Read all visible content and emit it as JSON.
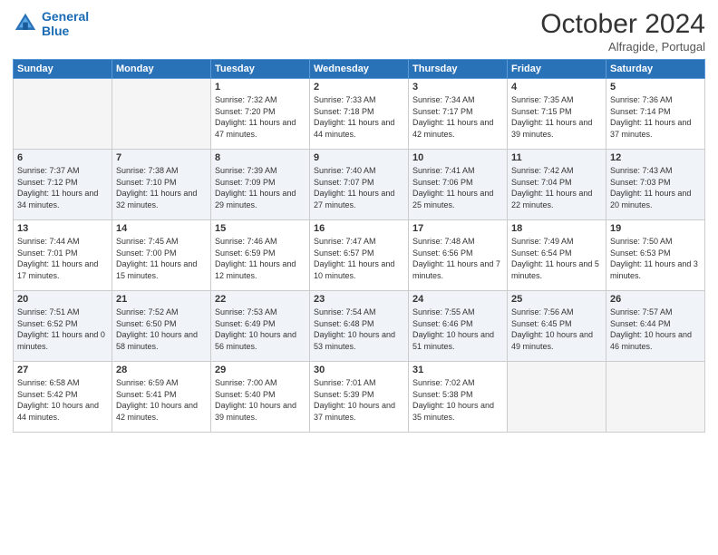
{
  "header": {
    "logo_line1": "General",
    "logo_line2": "Blue",
    "month_title": "October 2024",
    "location": "Alfragide, Portugal"
  },
  "days_of_week": [
    "Sunday",
    "Monday",
    "Tuesday",
    "Wednesday",
    "Thursday",
    "Friday",
    "Saturday"
  ],
  "weeks": [
    [
      {
        "day": "",
        "sunrise": "",
        "sunset": "",
        "daylight": "",
        "empty": true
      },
      {
        "day": "",
        "sunrise": "",
        "sunset": "",
        "daylight": "",
        "empty": true
      },
      {
        "day": "1",
        "sunrise": "Sunrise: 7:32 AM",
        "sunset": "Sunset: 7:20 PM",
        "daylight": "Daylight: 11 hours and 47 minutes.",
        "empty": false
      },
      {
        "day": "2",
        "sunrise": "Sunrise: 7:33 AM",
        "sunset": "Sunset: 7:18 PM",
        "daylight": "Daylight: 11 hours and 44 minutes.",
        "empty": false
      },
      {
        "day": "3",
        "sunrise": "Sunrise: 7:34 AM",
        "sunset": "Sunset: 7:17 PM",
        "daylight": "Daylight: 11 hours and 42 minutes.",
        "empty": false
      },
      {
        "day": "4",
        "sunrise": "Sunrise: 7:35 AM",
        "sunset": "Sunset: 7:15 PM",
        "daylight": "Daylight: 11 hours and 39 minutes.",
        "empty": false
      },
      {
        "day": "5",
        "sunrise": "Sunrise: 7:36 AM",
        "sunset": "Sunset: 7:14 PM",
        "daylight": "Daylight: 11 hours and 37 minutes.",
        "empty": false
      }
    ],
    [
      {
        "day": "6",
        "sunrise": "Sunrise: 7:37 AM",
        "sunset": "Sunset: 7:12 PM",
        "daylight": "Daylight: 11 hours and 34 minutes.",
        "empty": false
      },
      {
        "day": "7",
        "sunrise": "Sunrise: 7:38 AM",
        "sunset": "Sunset: 7:10 PM",
        "daylight": "Daylight: 11 hours and 32 minutes.",
        "empty": false
      },
      {
        "day": "8",
        "sunrise": "Sunrise: 7:39 AM",
        "sunset": "Sunset: 7:09 PM",
        "daylight": "Daylight: 11 hours and 29 minutes.",
        "empty": false
      },
      {
        "day": "9",
        "sunrise": "Sunrise: 7:40 AM",
        "sunset": "Sunset: 7:07 PM",
        "daylight": "Daylight: 11 hours and 27 minutes.",
        "empty": false
      },
      {
        "day": "10",
        "sunrise": "Sunrise: 7:41 AM",
        "sunset": "Sunset: 7:06 PM",
        "daylight": "Daylight: 11 hours and 25 minutes.",
        "empty": false
      },
      {
        "day": "11",
        "sunrise": "Sunrise: 7:42 AM",
        "sunset": "Sunset: 7:04 PM",
        "daylight": "Daylight: 11 hours and 22 minutes.",
        "empty": false
      },
      {
        "day": "12",
        "sunrise": "Sunrise: 7:43 AM",
        "sunset": "Sunset: 7:03 PM",
        "daylight": "Daylight: 11 hours and 20 minutes.",
        "empty": false
      }
    ],
    [
      {
        "day": "13",
        "sunrise": "Sunrise: 7:44 AM",
        "sunset": "Sunset: 7:01 PM",
        "daylight": "Daylight: 11 hours and 17 minutes.",
        "empty": false
      },
      {
        "day": "14",
        "sunrise": "Sunrise: 7:45 AM",
        "sunset": "Sunset: 7:00 PM",
        "daylight": "Daylight: 11 hours and 15 minutes.",
        "empty": false
      },
      {
        "day": "15",
        "sunrise": "Sunrise: 7:46 AM",
        "sunset": "Sunset: 6:59 PM",
        "daylight": "Daylight: 11 hours and 12 minutes.",
        "empty": false
      },
      {
        "day": "16",
        "sunrise": "Sunrise: 7:47 AM",
        "sunset": "Sunset: 6:57 PM",
        "daylight": "Daylight: 11 hours and 10 minutes.",
        "empty": false
      },
      {
        "day": "17",
        "sunrise": "Sunrise: 7:48 AM",
        "sunset": "Sunset: 6:56 PM",
        "daylight": "Daylight: 11 hours and 7 minutes.",
        "empty": false
      },
      {
        "day": "18",
        "sunrise": "Sunrise: 7:49 AM",
        "sunset": "Sunset: 6:54 PM",
        "daylight": "Daylight: 11 hours and 5 minutes.",
        "empty": false
      },
      {
        "day": "19",
        "sunrise": "Sunrise: 7:50 AM",
        "sunset": "Sunset: 6:53 PM",
        "daylight": "Daylight: 11 hours and 3 minutes.",
        "empty": false
      }
    ],
    [
      {
        "day": "20",
        "sunrise": "Sunrise: 7:51 AM",
        "sunset": "Sunset: 6:52 PM",
        "daylight": "Daylight: 11 hours and 0 minutes.",
        "empty": false
      },
      {
        "day": "21",
        "sunrise": "Sunrise: 7:52 AM",
        "sunset": "Sunset: 6:50 PM",
        "daylight": "Daylight: 10 hours and 58 minutes.",
        "empty": false
      },
      {
        "day": "22",
        "sunrise": "Sunrise: 7:53 AM",
        "sunset": "Sunset: 6:49 PM",
        "daylight": "Daylight: 10 hours and 56 minutes.",
        "empty": false
      },
      {
        "day": "23",
        "sunrise": "Sunrise: 7:54 AM",
        "sunset": "Sunset: 6:48 PM",
        "daylight": "Daylight: 10 hours and 53 minutes.",
        "empty": false
      },
      {
        "day": "24",
        "sunrise": "Sunrise: 7:55 AM",
        "sunset": "Sunset: 6:46 PM",
        "daylight": "Daylight: 10 hours and 51 minutes.",
        "empty": false
      },
      {
        "day": "25",
        "sunrise": "Sunrise: 7:56 AM",
        "sunset": "Sunset: 6:45 PM",
        "daylight": "Daylight: 10 hours and 49 minutes.",
        "empty": false
      },
      {
        "day": "26",
        "sunrise": "Sunrise: 7:57 AM",
        "sunset": "Sunset: 6:44 PM",
        "daylight": "Daylight: 10 hours and 46 minutes.",
        "empty": false
      }
    ],
    [
      {
        "day": "27",
        "sunrise": "Sunrise: 6:58 AM",
        "sunset": "Sunset: 5:42 PM",
        "daylight": "Daylight: 10 hours and 44 minutes.",
        "empty": false
      },
      {
        "day": "28",
        "sunrise": "Sunrise: 6:59 AM",
        "sunset": "Sunset: 5:41 PM",
        "daylight": "Daylight: 10 hours and 42 minutes.",
        "empty": false
      },
      {
        "day": "29",
        "sunrise": "Sunrise: 7:00 AM",
        "sunset": "Sunset: 5:40 PM",
        "daylight": "Daylight: 10 hours and 39 minutes.",
        "empty": false
      },
      {
        "day": "30",
        "sunrise": "Sunrise: 7:01 AM",
        "sunset": "Sunset: 5:39 PM",
        "daylight": "Daylight: 10 hours and 37 minutes.",
        "empty": false
      },
      {
        "day": "31",
        "sunrise": "Sunrise: 7:02 AM",
        "sunset": "Sunset: 5:38 PM",
        "daylight": "Daylight: 10 hours and 35 minutes.",
        "empty": false
      },
      {
        "day": "",
        "sunrise": "",
        "sunset": "",
        "daylight": "",
        "empty": true
      },
      {
        "day": "",
        "sunrise": "",
        "sunset": "",
        "daylight": "",
        "empty": true
      }
    ]
  ]
}
